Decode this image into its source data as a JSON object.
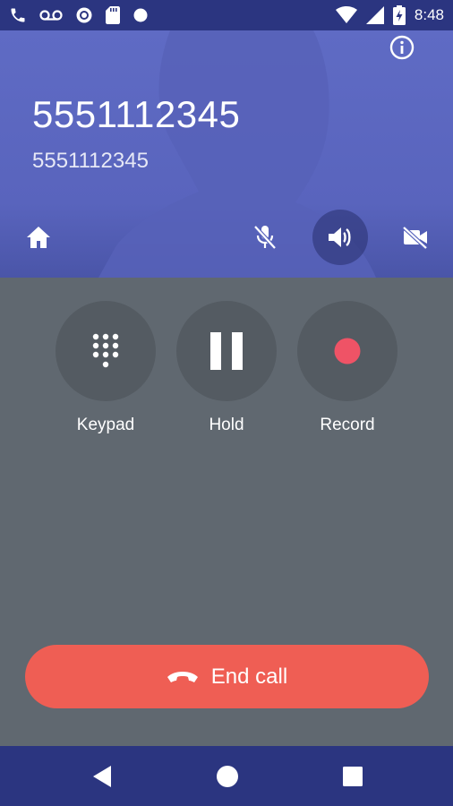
{
  "status_bar": {
    "time": "8:48",
    "left_icons": [
      "phone-icon",
      "voicemail-icon",
      "sync-icon",
      "sd-card-icon",
      "dot-icon"
    ],
    "right_icons": [
      "wifi-icon",
      "signal-icon",
      "battery-charging-icon"
    ]
  },
  "call": {
    "primary_number": "5551112345",
    "secondary_number": "5551112345"
  },
  "header_controls": [
    "home-icon",
    "mic-off-icon",
    "speaker-icon",
    "video-off-icon"
  ],
  "actions": {
    "keypad_label": "Keypad",
    "hold_label": "Hold",
    "record_label": "Record"
  },
  "end_call": {
    "label": "End call"
  },
  "colors": {
    "header": "#5f6bc4",
    "bars": "#2b3580",
    "body": "#606870",
    "action_circle": "#545b62",
    "end_call": "#ef5e54",
    "record": "#ef5366"
  }
}
